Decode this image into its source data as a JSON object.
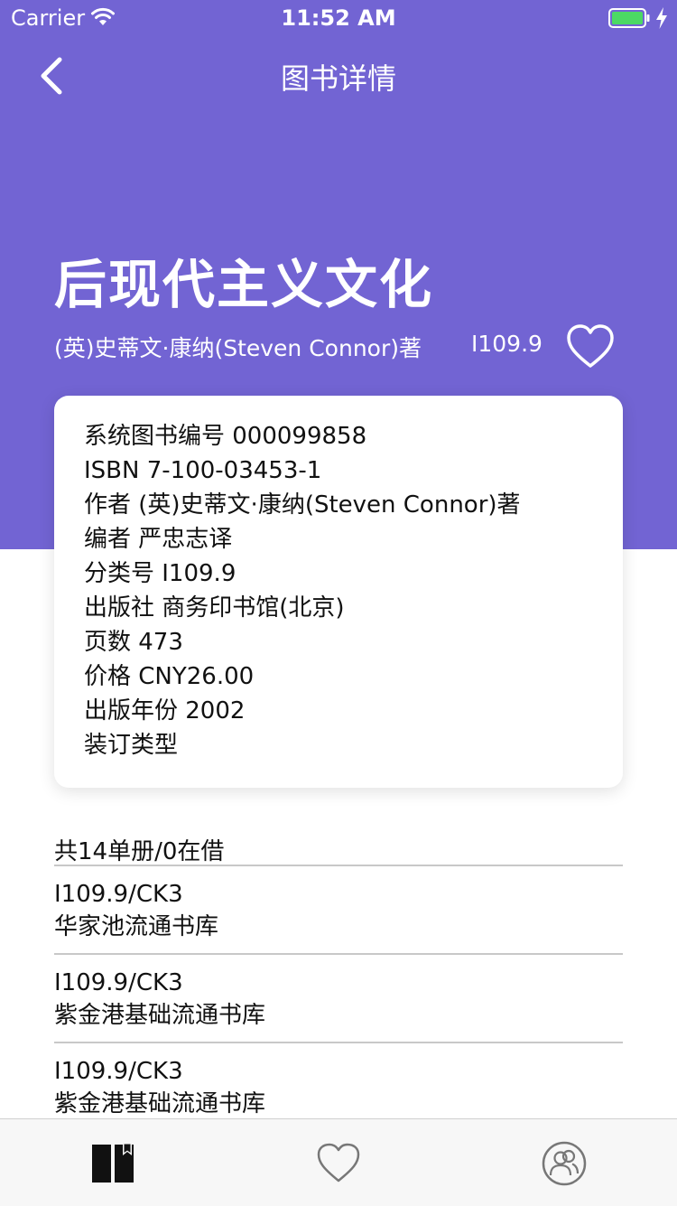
{
  "status_bar": {
    "carrier": "Carrier",
    "time": "11:52 AM",
    "wifi_icon": "wifi-icon",
    "battery_icon": "battery-full-icon",
    "charging_icon": "bolt-icon"
  },
  "nav": {
    "title": "图书详情",
    "back_icon": "chevron-left-icon"
  },
  "colors": {
    "header_background": "#7264d3",
    "battery": "#4cd964"
  },
  "book": {
    "title": "后现代主义文化",
    "author_line": "(英)史蒂文·康纳(Steven Connor)著",
    "call_number": "I109.9",
    "favorite_icon": "heart-outline-icon"
  },
  "details": [
    "系统图书编号 000099858",
    "ISBN 7-100-03453-1",
    "作者 (英)史蒂文·康纳(Steven Connor)著",
    "编者 严忠志译",
    "分类号 I109.9",
    "出版社 商务印书馆(北京)",
    "页数 473",
    "价格 CNY26.00",
    "出版年份 2002",
    "装订类型"
  ],
  "holdings": {
    "summary": "共14单册/0在借",
    "items": [
      {
        "call_number": "I109.9/CK3",
        "location": "华家池流通书库"
      },
      {
        "call_number": "I109.9/CK3",
        "location": "紫金港基础流通书库"
      },
      {
        "call_number": "I109.9/CK3",
        "location": "紫金港基础流通书库"
      }
    ]
  },
  "tab_bar": {
    "tabs": [
      {
        "icon": "book-icon",
        "selected": true
      },
      {
        "icon": "heart-icon",
        "selected": false
      },
      {
        "icon": "user-group-icon",
        "selected": false
      }
    ]
  }
}
